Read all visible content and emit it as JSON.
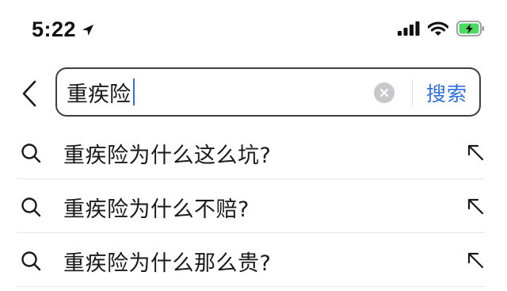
{
  "status_bar": {
    "time": "5:22",
    "icons": [
      "location-arrow-icon",
      "cellular-signal-icon",
      "wifi-icon",
      "battery-charging-icon"
    ],
    "battery_color": "#4cd964"
  },
  "search": {
    "query": "重疾险",
    "submit_label": "搜索",
    "accent_color": "#2f6fe0"
  },
  "suggestions": [
    {
      "text": "重疾险为什么这么坑?"
    },
    {
      "text": "重疾险为什么不赔?"
    },
    {
      "text": "重疾险为什么那么贵?"
    }
  ]
}
